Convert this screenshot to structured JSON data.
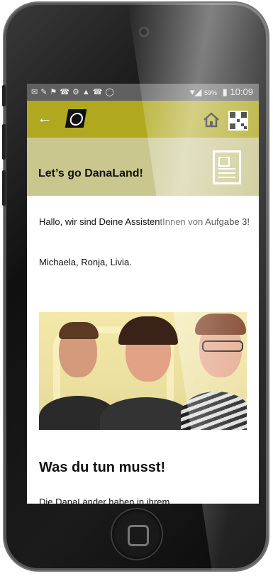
{
  "status_bar": {
    "battery_percent": "59%",
    "time": "10:09"
  },
  "app_bar": {
    "back_icon": "arrow-left-icon",
    "logo_icon": "danaland-logo-icon",
    "home_icon": "home-icon",
    "qr_icon": "qr-code-icon",
    "color": "#b0a81f"
  },
  "header": {
    "title": "Let’s go DanaLand!",
    "icon": "document-icon",
    "color": "#c9c78e"
  },
  "content": {
    "intro": "Hallo, wir sind Deine AssistentInnen von Aufgabe 3!",
    "names": "Michaela, Ronja, Livia.",
    "section_title": "Was du tun musst!",
    "next_text": "Die DanaLänder haben in ihrem"
  }
}
